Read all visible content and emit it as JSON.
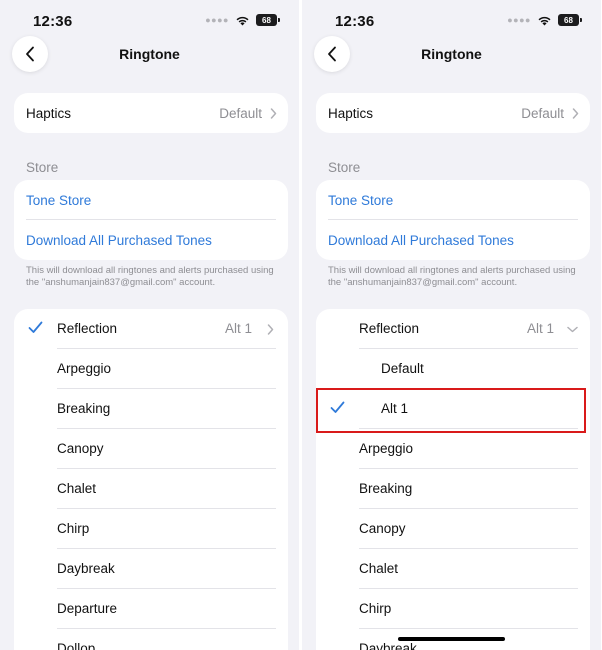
{
  "status": {
    "time": "12:36",
    "battery": "68",
    "wifi_icon": "wifi-icon"
  },
  "nav": {
    "title": "Ringtone",
    "back_icon": "chevron-left-icon"
  },
  "haptics": {
    "label": "Haptics",
    "value": "Default"
  },
  "store": {
    "header": "Store",
    "tone_store": "Tone Store",
    "download_all": "Download All Purchased Tones",
    "footnote": "This will download all ringtones and alerts purchased using the \"anshumanjain837@gmail.com\" account."
  },
  "left_list": {
    "selected": {
      "label": "Reflection",
      "value": "Alt 1"
    },
    "items": [
      "Arpeggio",
      "Breaking",
      "Canopy",
      "Chalet",
      "Chirp",
      "Daybreak",
      "Departure",
      "Dollop"
    ]
  },
  "right_list": {
    "expanded": {
      "label": "Reflection",
      "value": "Alt 1"
    },
    "options": [
      {
        "label": "Default",
        "checked": false
      },
      {
        "label": "Alt 1",
        "checked": true
      }
    ],
    "items": [
      "Arpeggio",
      "Breaking",
      "Canopy",
      "Chalet",
      "Chirp",
      "Daybreak"
    ]
  },
  "colors": {
    "accent": "#2f7ad9",
    "highlight": "#d91a1a",
    "background": "#f2f2f7"
  }
}
